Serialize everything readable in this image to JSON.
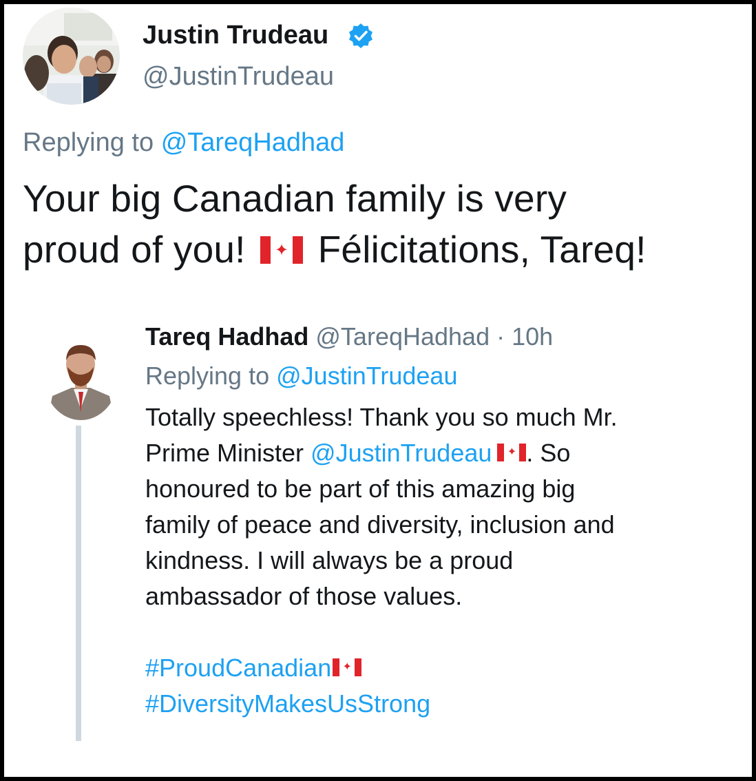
{
  "tweet": {
    "author": {
      "name": "Justin Trudeau",
      "handle": "@JustinTrudeau",
      "verified_icon": "verified-badge-icon",
      "avatar_icon": "avatar-photo"
    },
    "reply_context_prefix": "Replying to",
    "reply_context_handle": "@TareqHadhad",
    "text_line1": "Your big Canadian family is very",
    "text_line2_a": "proud of you!",
    "text_line2_b": "Félicitations, Tareq!",
    "flag_icon": "canada-flag-icon"
  },
  "quoted_reply": {
    "author_name": "Tareq Hadhad",
    "author_handle": "@TareqHadhad",
    "separator": "·",
    "time": "10h",
    "reply_context_prefix": "Replying to",
    "reply_context_handle": "@JustinTrudeau",
    "body_line1": "Totally speechless! Thank you so much Mr.",
    "body_line2_a": "Prime Minister",
    "body_line2_mention": "@JustinTrudeau",
    "body_line2_b": ". So",
    "body_line3": "honoured to be part of this amazing big",
    "body_line4": "family of peace and diversity, inclusion and",
    "body_line5": "kindness. I will always be a proud",
    "body_line6": "ambassador of those values.",
    "hashtag1": "#ProudCanadian",
    "hashtag2": "#DiversityMakesUsStrong"
  },
  "colors": {
    "link": "#1da1f2",
    "muted": "#657786",
    "text": "#14171a",
    "thread_line": "#cfd8de",
    "flag_red": "#e0242a",
    "verified": "#1da1f2"
  }
}
